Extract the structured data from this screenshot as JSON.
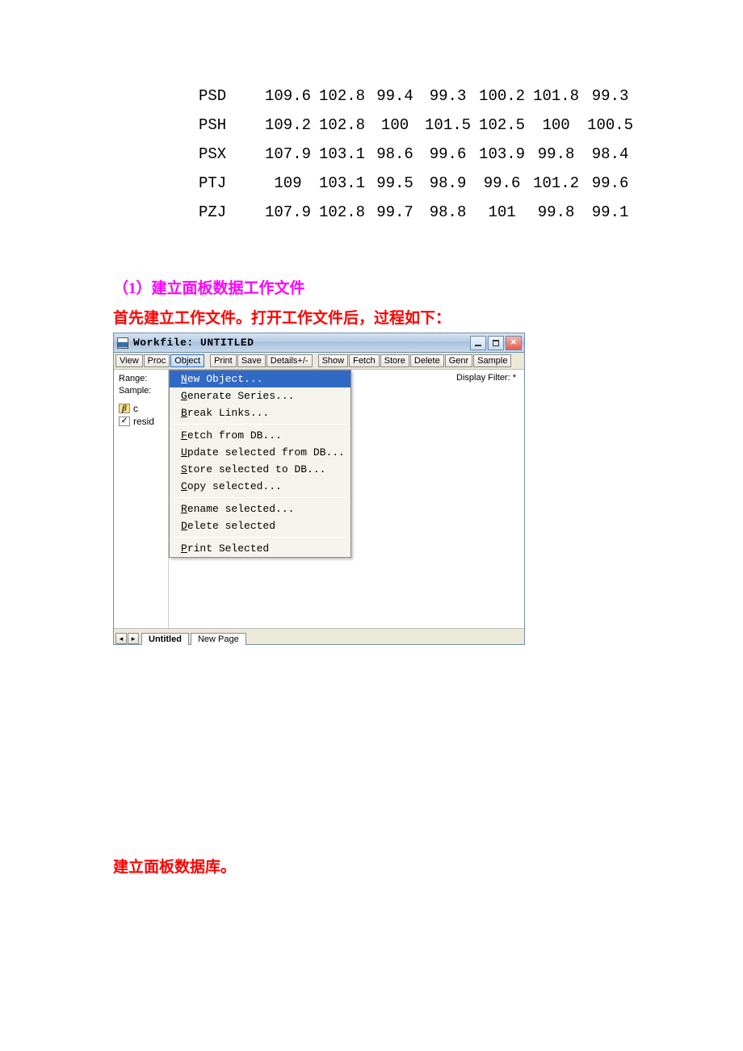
{
  "table": {
    "rows": [
      {
        "label": "PSD",
        "v": [
          "109.6",
          "102.8",
          "99.4",
          "99.3",
          "100.2",
          "101.8",
          "99.3"
        ]
      },
      {
        "label": "PSH",
        "v": [
          "109.2",
          "102.8",
          "100",
          "101.5",
          "102.5",
          "100",
          "100.5"
        ]
      },
      {
        "label": "PSX",
        "v": [
          "107.9",
          "103.1",
          "98.6",
          "99.6",
          "103.9",
          "99.8",
          "98.4"
        ]
      },
      {
        "label": "PTJ",
        "v": [
          "109",
          "103.1",
          "99.5",
          "98.9",
          "99.6",
          "101.2",
          "99.6"
        ]
      },
      {
        "label": "PZJ",
        "v": [
          "107.9",
          "102.8",
          "99.7",
          "98.8",
          "101",
          "99.8",
          "99.1"
        ]
      }
    ]
  },
  "headings": {
    "section": "（1）建立面板数据工作文件",
    "step1": "首先建立工作文件。打开工作文件后，过程如下：",
    "step2": "建立面板数据库。"
  },
  "win": {
    "title": "Workfile: UNTITLED",
    "display_filter": "Display Filter: *",
    "toolbar_g1": [
      "View",
      "Proc",
      "Object"
    ],
    "toolbar_g2": [
      "Print",
      "Save",
      "Details+/-"
    ],
    "toolbar_g3": [
      "Show",
      "Fetch",
      "Store",
      "Delete",
      "Genr",
      "Sample"
    ],
    "left": {
      "range": "Range:",
      "sample": "Sample:",
      "items": [
        {
          "icon": "beta",
          "label": "c"
        },
        {
          "icon": "resid",
          "label": "resid"
        }
      ]
    },
    "menu": {
      "items": [
        {
          "html": "<span class='u'>N</span>ew Object..."
        },
        {
          "html": "<span class='u'>G</span>enerate Series..."
        },
        {
          "html": "<span class='u'>B</span>reak Links..."
        },
        {
          "sep": true
        },
        {
          "html": "<span class='u'>F</span>etch from DB..."
        },
        {
          "html": "<span class='u'>U</span>pdate selected from DB..."
        },
        {
          "html": "<span class='u'>S</span>tore selected to DB..."
        },
        {
          "html": "<span class='u'>C</span>opy selected..."
        },
        {
          "sep": true
        },
        {
          "html": "<span class='u'>R</span>ename selected..."
        },
        {
          "html": "<span class='u'>D</span>elete selected"
        },
        {
          "sep": true
        },
        {
          "html": "<span class='u'>P</span>rint Selected"
        }
      ]
    },
    "tabs": {
      "active": "Untitled",
      "other": "New Page"
    }
  }
}
